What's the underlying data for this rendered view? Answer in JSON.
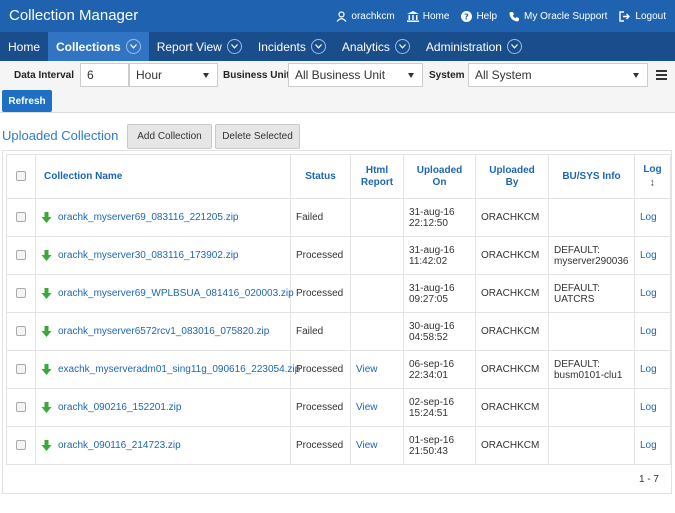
{
  "header": {
    "title": "Collection Manager",
    "user": "orachkcm",
    "home": "Home",
    "help": "Help",
    "support": "My Oracle Support",
    "logout": "Logout"
  },
  "nav": {
    "items": [
      {
        "label": "Home",
        "has_menu": false,
        "active": false
      },
      {
        "label": "Collections",
        "has_menu": true,
        "active": true
      },
      {
        "label": "Report View",
        "has_menu": true,
        "active": false
      },
      {
        "label": "Incidents",
        "has_menu": true,
        "active": false
      },
      {
        "label": "Analytics",
        "has_menu": true,
        "active": false
      },
      {
        "label": "Administration",
        "has_menu": true,
        "active": false
      }
    ]
  },
  "filters": {
    "data_interval_label": "Data Interval",
    "interval_value": "6",
    "interval_unit": "Hour",
    "business_unit_label": "Business Unit",
    "business_unit_value": "All Business Unit",
    "system_label": "System",
    "system_value": "All System",
    "refresh_label": "Refresh"
  },
  "panel": {
    "title": "Uploaded Collection",
    "add_label": "Add Collection",
    "delete_label": "Delete Selected"
  },
  "table": {
    "headers": {
      "name": "Collection Name",
      "status": "Status",
      "html_report_1": "Html",
      "html_report_2": "Report",
      "uploaded_on_1": "Uploaded",
      "uploaded_on_2": "On",
      "uploaded_by_1": "Uploaded",
      "uploaded_by_2": "By",
      "info": "BU/SYS Info",
      "log": "Log"
    },
    "rows": [
      {
        "name": "orachk_myserver69_083116_221205.zip",
        "status": "Failed",
        "report": "",
        "date": "31-aug-16",
        "time": "22:12:50",
        "by": "ORACHKCM",
        "info1": "",
        "info2": "",
        "log": "Log"
      },
      {
        "name": "orachk_myserver30_083116_173902.zip",
        "status": "Processed",
        "report": "",
        "date": "31-aug-16",
        "time": "11:42:02",
        "by": "ORACHKCM",
        "info1": "DEFAULT:",
        "info2": "myserver290036",
        "log": "Log"
      },
      {
        "name": "orachk_myserver69_WPLBSUA_081416_020003.zip",
        "status": "Processed",
        "report": "",
        "date": "31-aug-16",
        "time": "09:27:05",
        "by": "ORACHKCM",
        "info1": "DEFAULT:",
        "info2": "UATCRS",
        "log": "Log"
      },
      {
        "name": "orachk_myserver6572rcv1_083016_075820.zip",
        "status": "Failed",
        "report": "",
        "date": "30-aug-16",
        "time": "04:58:52",
        "by": "ORACHKCM",
        "info1": "",
        "info2": "",
        "log": "Log"
      },
      {
        "name": "exachk_myserveradm01_sing11g_090616_223054.zip",
        "status": "Processed",
        "report": "View",
        "date": "06-sep-16",
        "time": "22:34:01",
        "by": "ORACHKCM",
        "info1": "DEFAULT:",
        "info2": "busm0101-clu1",
        "log": "Log"
      },
      {
        "name": "orachk_090216_152201.zip",
        "status": "Processed",
        "report": "View",
        "date": "02-sep-16",
        "time": "15:24:51",
        "by": "ORACHKCM",
        "info1": "",
        "info2": "",
        "log": "Log"
      },
      {
        "name": "orachk_090116_214723.zip",
        "status": "Processed",
        "report": "View",
        "date": "01-sep-16",
        "time": "21:50:43",
        "by": "ORACHKCM",
        "info1": "",
        "info2": "",
        "log": "Log"
      }
    ],
    "pager": "1 - 7"
  },
  "colors": {
    "topbar": "#1e62b0",
    "navbar": "#1a4d8c",
    "nav_active": "#3174c4",
    "link": "#1e66b5",
    "download_icon": "#3aa83a"
  }
}
